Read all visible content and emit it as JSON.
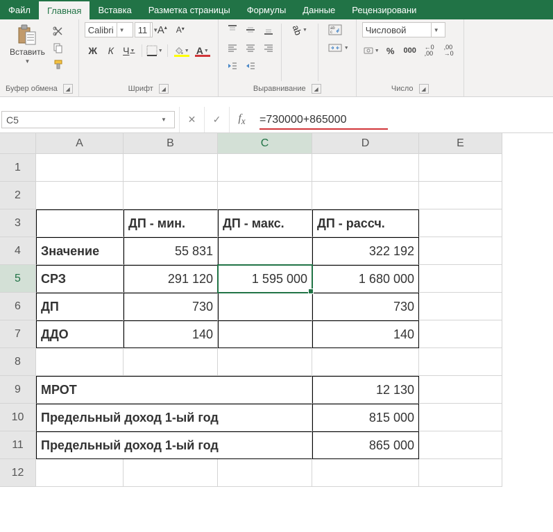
{
  "tabs": {
    "file": "Файл",
    "home": "Главная",
    "insert": "Вставка",
    "pagelayout": "Разметка страницы",
    "formulas": "Формулы",
    "data": "Данные",
    "review": "Рецензировани"
  },
  "ribbon": {
    "clipboard": {
      "paste": "Вставить",
      "label": "Буфер обмена"
    },
    "font": {
      "name": "Calibri",
      "size": "11",
      "bold": "Ж",
      "italic": "К",
      "underline": "Ч",
      "grow": "A",
      "shrink": "A",
      "label": "Шрифт",
      "fontA": "А"
    },
    "alignment": {
      "label": "Выравнивание"
    },
    "number": {
      "format": "Числовой",
      "label": "Число"
    }
  },
  "formula_bar": {
    "cellref": "C5",
    "formula": "=730000+865000"
  },
  "columns": [
    "A",
    "B",
    "C",
    "D",
    "E"
  ],
  "rows": [
    "1",
    "2",
    "3",
    "4",
    "5",
    "6",
    "7",
    "8",
    "9",
    "10",
    "11",
    "12"
  ],
  "sheet": {
    "B3": "ДП - мин.",
    "C3": "ДП - макс.",
    "D3": "ДП - рассч.",
    "A4": "Значение",
    "B4": "55 831",
    "D4": "322 192",
    "A5": "СРЗ",
    "B5": "291 120",
    "C5": "1 595 000",
    "D5": "1 680 000",
    "A6": "ДП",
    "B6": "730",
    "D6": "730",
    "A7": "ДДО",
    "B7": "140",
    "D7": "140",
    "A9": "МРОТ",
    "D9": "12 130",
    "A10": "Предельный доход 1-ый год",
    "D10": "815 000",
    "A11": "Предельный доход 1-ый год",
    "D11": "865 000"
  }
}
